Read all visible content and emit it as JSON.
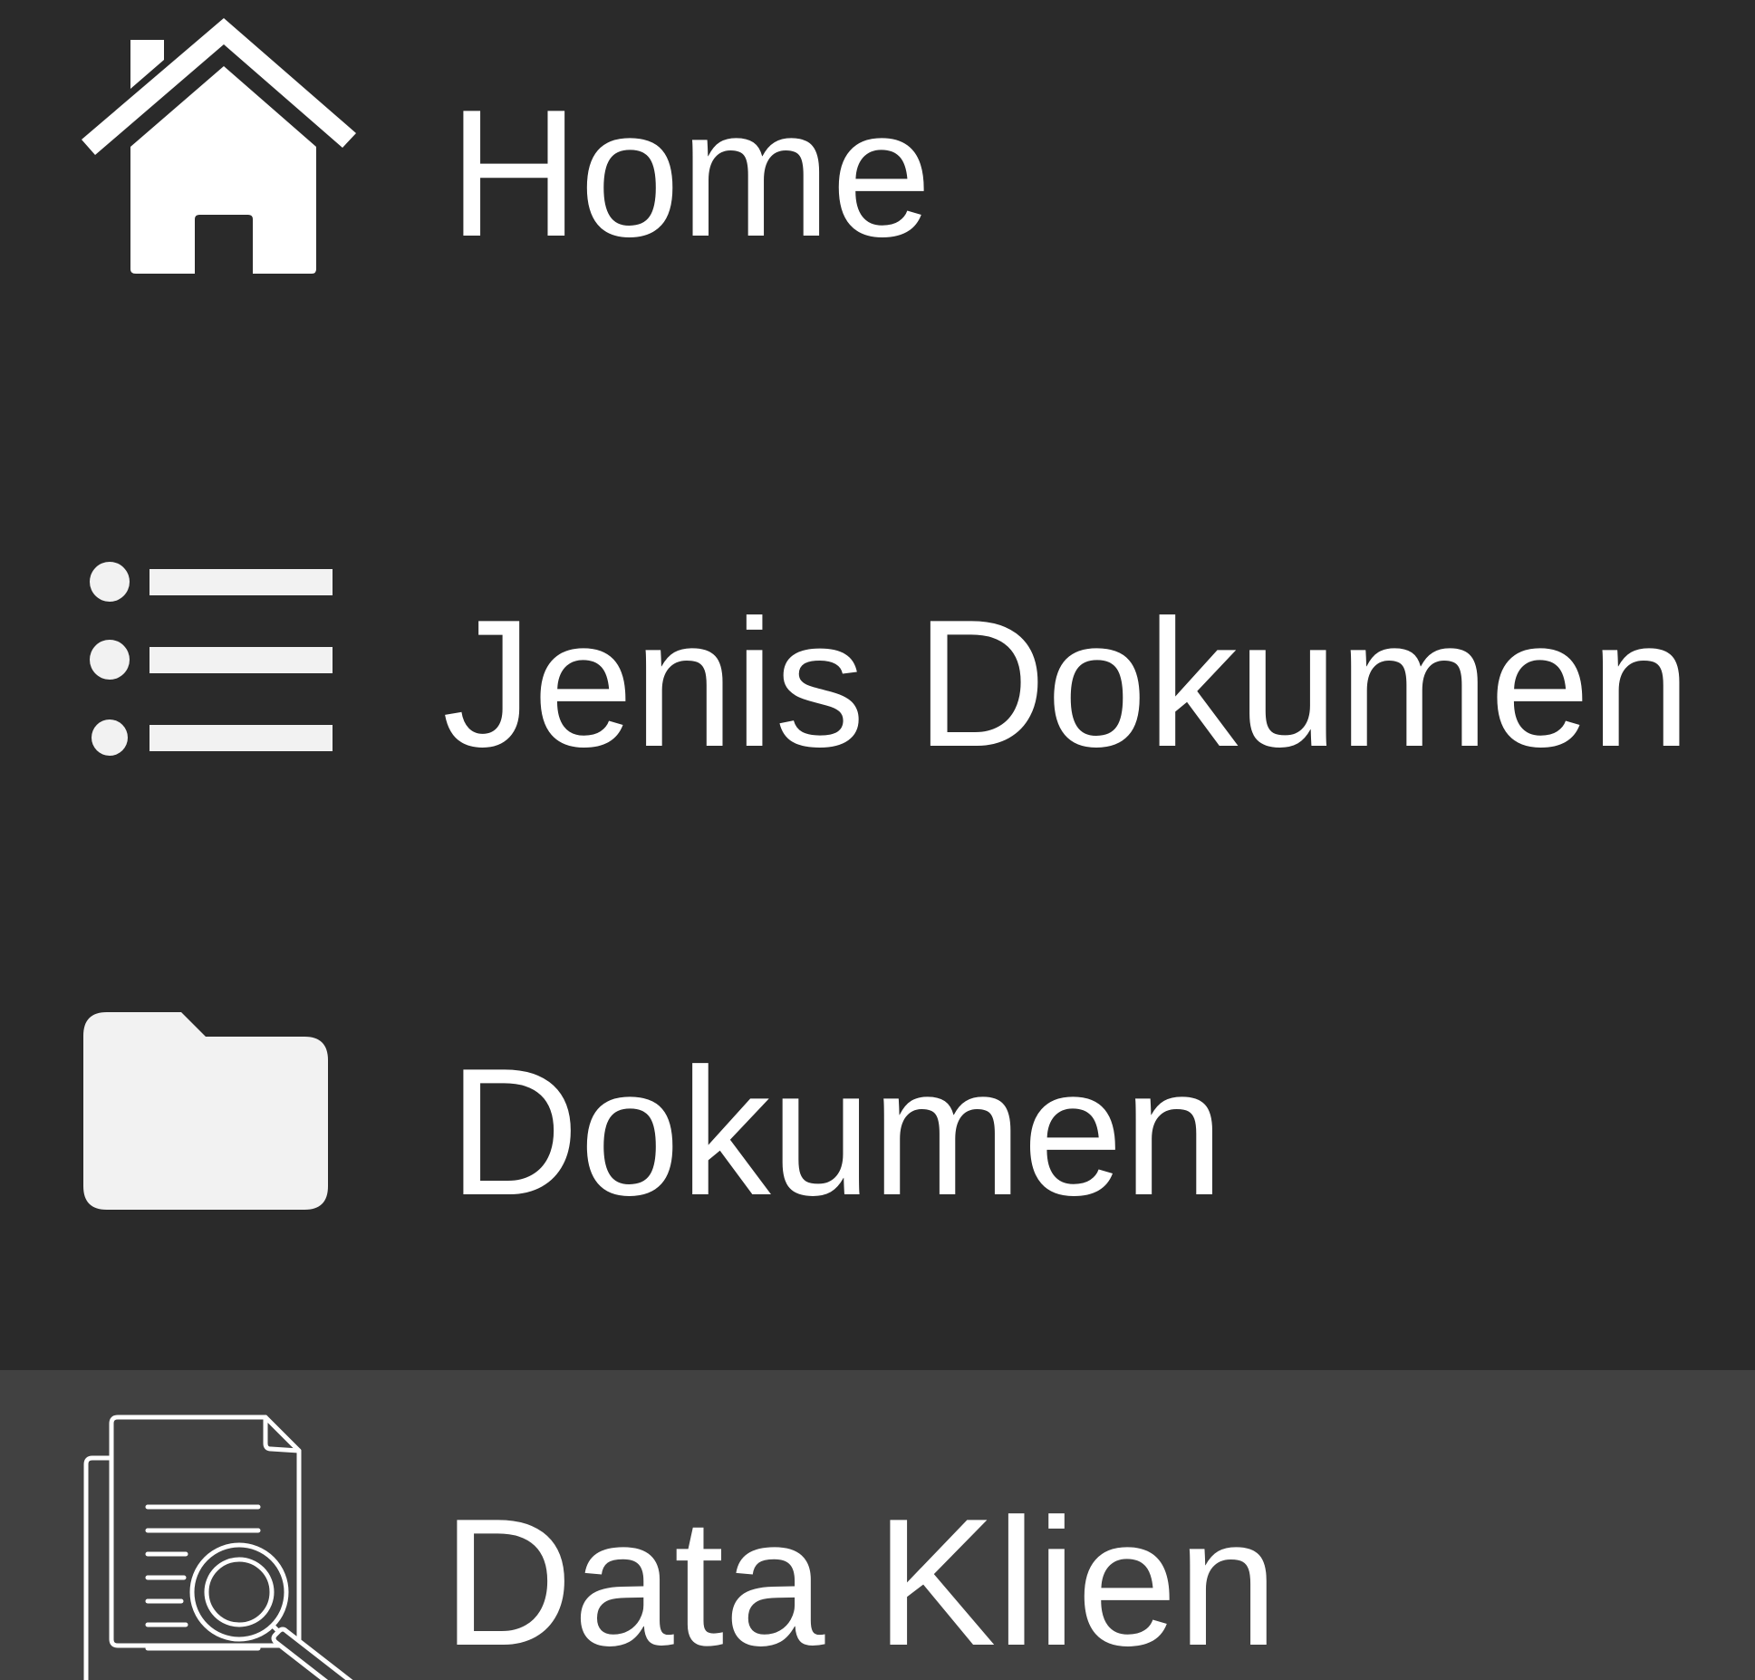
{
  "sidebar": {
    "items": [
      {
        "label": "Home",
        "icon": "home-icon",
        "active": false
      },
      {
        "label": "Jenis Dokumen",
        "icon": "list-icon",
        "active": false
      },
      {
        "label": "Dokumen",
        "icon": "folder-icon",
        "active": false
      },
      {
        "label": "Data Klien",
        "icon": "document-search-icon",
        "active": true
      }
    ]
  },
  "colors": {
    "background": "#2a2a2a",
    "active_background": "#414141",
    "text": "#ffffff",
    "icon": "#f2f2f2"
  }
}
